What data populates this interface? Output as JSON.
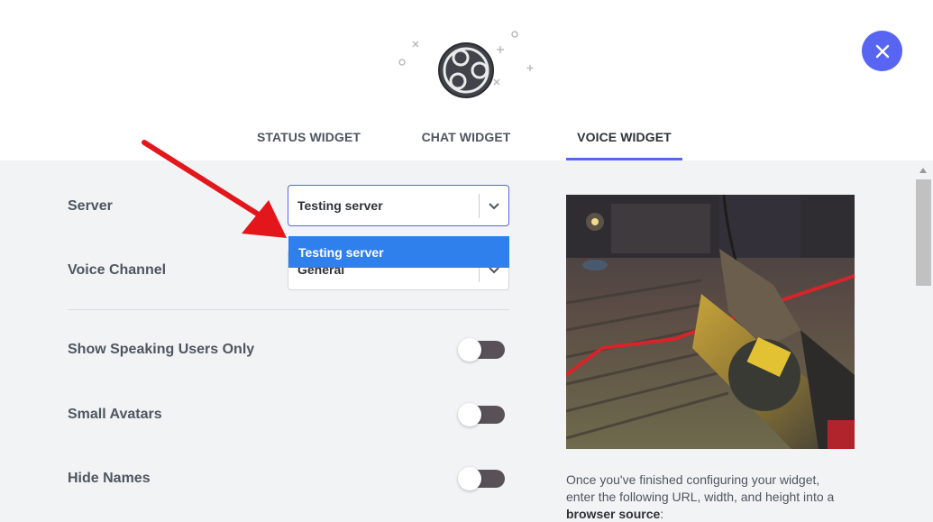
{
  "tabs": [
    {
      "label": "STATUS WIDGET",
      "active": false
    },
    {
      "label": "CHAT WIDGET",
      "active": false
    },
    {
      "label": "VOICE WIDGET",
      "active": true
    }
  ],
  "close_icon": "close-icon",
  "form": {
    "server_label": "Server",
    "server_value": "Testing server",
    "server_dropdown_options": [
      "Testing server"
    ],
    "voice_channel_label": "Voice Channel",
    "voice_channel_value": "General",
    "toggles": [
      {
        "label": "Show Speaking Users Only",
        "on": false
      },
      {
        "label": "Small Avatars",
        "on": false
      },
      {
        "label": "Hide Names",
        "on": false
      }
    ]
  },
  "help": {
    "text_before": "Once you've finished configuring your widget, enter the following URL, width, and height into a ",
    "text_bold": "browser source",
    "text_after": ":"
  },
  "colors": {
    "accent": "#5865f2",
    "dropdown_highlight": "#2f80ed",
    "annotation_arrow": "#e3161b"
  }
}
